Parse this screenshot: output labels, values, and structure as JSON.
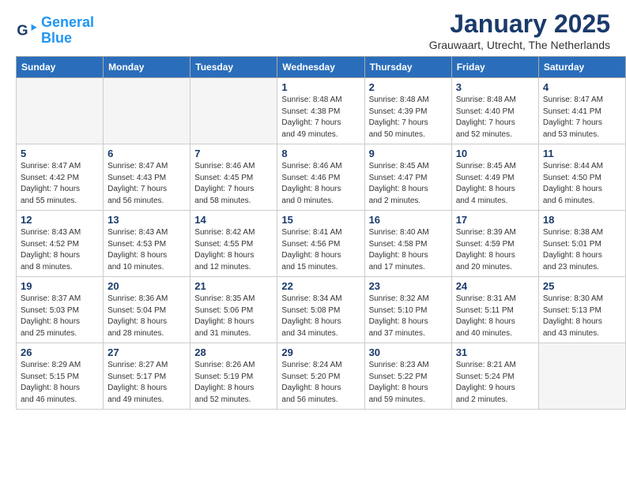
{
  "header": {
    "logo_line1": "General",
    "logo_line2": "Blue",
    "month": "January 2025",
    "location": "Grauwaart, Utrecht, The Netherlands"
  },
  "days_of_week": [
    "Sunday",
    "Monday",
    "Tuesday",
    "Wednesday",
    "Thursday",
    "Friday",
    "Saturday"
  ],
  "weeks": [
    [
      {
        "day": "",
        "info": ""
      },
      {
        "day": "",
        "info": ""
      },
      {
        "day": "",
        "info": ""
      },
      {
        "day": "1",
        "info": "Sunrise: 8:48 AM\nSunset: 4:38 PM\nDaylight: 7 hours\nand 49 minutes."
      },
      {
        "day": "2",
        "info": "Sunrise: 8:48 AM\nSunset: 4:39 PM\nDaylight: 7 hours\nand 50 minutes."
      },
      {
        "day": "3",
        "info": "Sunrise: 8:48 AM\nSunset: 4:40 PM\nDaylight: 7 hours\nand 52 minutes."
      },
      {
        "day": "4",
        "info": "Sunrise: 8:47 AM\nSunset: 4:41 PM\nDaylight: 7 hours\nand 53 minutes."
      }
    ],
    [
      {
        "day": "5",
        "info": "Sunrise: 8:47 AM\nSunset: 4:42 PM\nDaylight: 7 hours\nand 55 minutes."
      },
      {
        "day": "6",
        "info": "Sunrise: 8:47 AM\nSunset: 4:43 PM\nDaylight: 7 hours\nand 56 minutes."
      },
      {
        "day": "7",
        "info": "Sunrise: 8:46 AM\nSunset: 4:45 PM\nDaylight: 7 hours\nand 58 minutes."
      },
      {
        "day": "8",
        "info": "Sunrise: 8:46 AM\nSunset: 4:46 PM\nDaylight: 8 hours\nand 0 minutes."
      },
      {
        "day": "9",
        "info": "Sunrise: 8:45 AM\nSunset: 4:47 PM\nDaylight: 8 hours\nand 2 minutes."
      },
      {
        "day": "10",
        "info": "Sunrise: 8:45 AM\nSunset: 4:49 PM\nDaylight: 8 hours\nand 4 minutes."
      },
      {
        "day": "11",
        "info": "Sunrise: 8:44 AM\nSunset: 4:50 PM\nDaylight: 8 hours\nand 6 minutes."
      }
    ],
    [
      {
        "day": "12",
        "info": "Sunrise: 8:43 AM\nSunset: 4:52 PM\nDaylight: 8 hours\nand 8 minutes."
      },
      {
        "day": "13",
        "info": "Sunrise: 8:43 AM\nSunset: 4:53 PM\nDaylight: 8 hours\nand 10 minutes."
      },
      {
        "day": "14",
        "info": "Sunrise: 8:42 AM\nSunset: 4:55 PM\nDaylight: 8 hours\nand 12 minutes."
      },
      {
        "day": "15",
        "info": "Sunrise: 8:41 AM\nSunset: 4:56 PM\nDaylight: 8 hours\nand 15 minutes."
      },
      {
        "day": "16",
        "info": "Sunrise: 8:40 AM\nSunset: 4:58 PM\nDaylight: 8 hours\nand 17 minutes."
      },
      {
        "day": "17",
        "info": "Sunrise: 8:39 AM\nSunset: 4:59 PM\nDaylight: 8 hours\nand 20 minutes."
      },
      {
        "day": "18",
        "info": "Sunrise: 8:38 AM\nSunset: 5:01 PM\nDaylight: 8 hours\nand 23 minutes."
      }
    ],
    [
      {
        "day": "19",
        "info": "Sunrise: 8:37 AM\nSunset: 5:03 PM\nDaylight: 8 hours\nand 25 minutes."
      },
      {
        "day": "20",
        "info": "Sunrise: 8:36 AM\nSunset: 5:04 PM\nDaylight: 8 hours\nand 28 minutes."
      },
      {
        "day": "21",
        "info": "Sunrise: 8:35 AM\nSunset: 5:06 PM\nDaylight: 8 hours\nand 31 minutes."
      },
      {
        "day": "22",
        "info": "Sunrise: 8:34 AM\nSunset: 5:08 PM\nDaylight: 8 hours\nand 34 minutes."
      },
      {
        "day": "23",
        "info": "Sunrise: 8:32 AM\nSunset: 5:10 PM\nDaylight: 8 hours\nand 37 minutes."
      },
      {
        "day": "24",
        "info": "Sunrise: 8:31 AM\nSunset: 5:11 PM\nDaylight: 8 hours\nand 40 minutes."
      },
      {
        "day": "25",
        "info": "Sunrise: 8:30 AM\nSunset: 5:13 PM\nDaylight: 8 hours\nand 43 minutes."
      }
    ],
    [
      {
        "day": "26",
        "info": "Sunrise: 8:29 AM\nSunset: 5:15 PM\nDaylight: 8 hours\nand 46 minutes."
      },
      {
        "day": "27",
        "info": "Sunrise: 8:27 AM\nSunset: 5:17 PM\nDaylight: 8 hours\nand 49 minutes."
      },
      {
        "day": "28",
        "info": "Sunrise: 8:26 AM\nSunset: 5:19 PM\nDaylight: 8 hours\nand 52 minutes."
      },
      {
        "day": "29",
        "info": "Sunrise: 8:24 AM\nSunset: 5:20 PM\nDaylight: 8 hours\nand 56 minutes."
      },
      {
        "day": "30",
        "info": "Sunrise: 8:23 AM\nSunset: 5:22 PM\nDaylight: 8 hours\nand 59 minutes."
      },
      {
        "day": "31",
        "info": "Sunrise: 8:21 AM\nSunset: 5:24 PM\nDaylight: 9 hours\nand 2 minutes."
      },
      {
        "day": "",
        "info": ""
      }
    ]
  ]
}
